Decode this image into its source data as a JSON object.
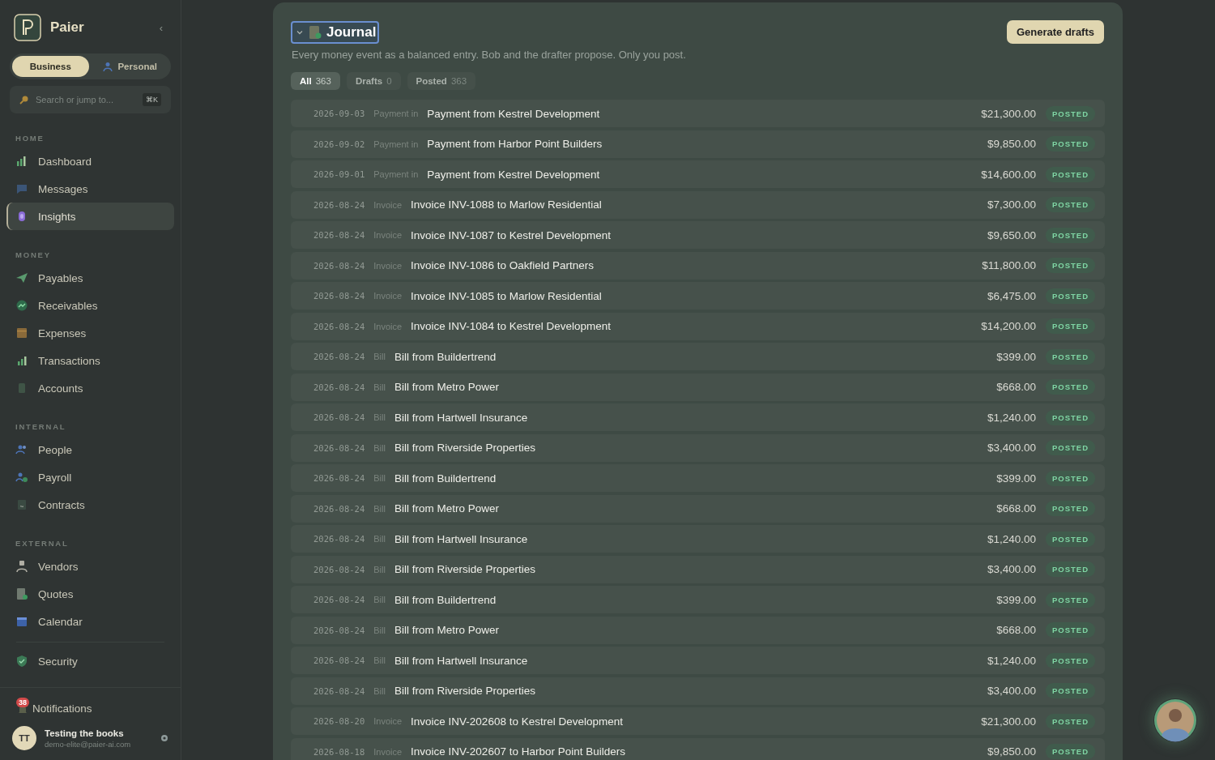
{
  "sidebar": {
    "brand": "Paier",
    "collapse_glyph": "‹",
    "modes": [
      {
        "label": "Business",
        "selected": true
      },
      {
        "label": "Personal",
        "selected": false
      }
    ],
    "search": {
      "placeholder": "Search or jump to...",
      "shortcut": "⌘K"
    },
    "sections": [
      {
        "title": "HOME",
        "items": [
          {
            "label": "Dashboard",
            "selected": false
          },
          {
            "label": "Messages",
            "selected": false
          },
          {
            "label": "Insights",
            "selected": true
          }
        ]
      },
      {
        "title": "MONEY",
        "items": [
          {
            "label": "Payables",
            "selected": false
          },
          {
            "label": "Receivables",
            "selected": false
          },
          {
            "label": "Expenses",
            "selected": false
          },
          {
            "label": "Transactions",
            "selected": false
          },
          {
            "label": "Accounts",
            "selected": false
          }
        ]
      },
      {
        "title": "INTERNAL",
        "items": [
          {
            "label": "People",
            "selected": false
          },
          {
            "label": "Payroll",
            "selected": false
          },
          {
            "label": "Contracts",
            "selected": false
          }
        ]
      },
      {
        "title": "EXTERNAL",
        "items": [
          {
            "label": "Vendors",
            "selected": false
          },
          {
            "label": "Quotes",
            "selected": false
          },
          {
            "label": "Calendar",
            "selected": false
          }
        ]
      }
    ],
    "footer_items": [
      {
        "label": "Security",
        "selected": false
      }
    ],
    "notifications": {
      "label": "Notifications",
      "count": "38"
    },
    "user": {
      "initials": "TT",
      "name": "Testing the books",
      "email": "demo-elite@paier-ai.com"
    }
  },
  "journal": {
    "title": "Journal",
    "description": "Every money event as a balanced entry. Bob and the drafter propose. Only you post.",
    "action": "Generate drafts",
    "tabs": [
      {
        "label": "All",
        "count": "363",
        "selected": true
      },
      {
        "label": "Drafts",
        "count": "0",
        "selected": false
      },
      {
        "label": "Posted",
        "count": "363",
        "selected": false
      }
    ],
    "rows": [
      {
        "date": "2026-09-03",
        "type": "Payment in",
        "description": "Payment from Kestrel Development",
        "amount": "$21,300.00",
        "status": "POSTED"
      },
      {
        "date": "2026-09-02",
        "type": "Payment in",
        "description": "Payment from Harbor Point Builders",
        "amount": "$9,850.00",
        "status": "POSTED"
      },
      {
        "date": "2026-09-01",
        "type": "Payment in",
        "description": "Payment from Kestrel Development",
        "amount": "$14,600.00",
        "status": "POSTED"
      },
      {
        "date": "2026-08-24",
        "type": "Invoice",
        "description": "Invoice INV-1088 to Marlow Residential",
        "amount": "$7,300.00",
        "status": "POSTED"
      },
      {
        "date": "2026-08-24",
        "type": "Invoice",
        "description": "Invoice INV-1087 to Kestrel Development",
        "amount": "$9,650.00",
        "status": "POSTED"
      },
      {
        "date": "2026-08-24",
        "type": "Invoice",
        "description": "Invoice INV-1086 to Oakfield Partners",
        "amount": "$11,800.00",
        "status": "POSTED"
      },
      {
        "date": "2026-08-24",
        "type": "Invoice",
        "description": "Invoice INV-1085 to Marlow Residential",
        "amount": "$6,475.00",
        "status": "POSTED"
      },
      {
        "date": "2026-08-24",
        "type": "Invoice",
        "description": "Invoice INV-1084 to Kestrel Development",
        "amount": "$14,200.00",
        "status": "POSTED"
      },
      {
        "date": "2026-08-24",
        "type": "Bill",
        "description": "Bill from Buildertrend",
        "amount": "$399.00",
        "status": "POSTED"
      },
      {
        "date": "2026-08-24",
        "type": "Bill",
        "description": "Bill from Metro Power",
        "amount": "$668.00",
        "status": "POSTED"
      },
      {
        "date": "2026-08-24",
        "type": "Bill",
        "description": "Bill from Hartwell Insurance",
        "amount": "$1,240.00",
        "status": "POSTED"
      },
      {
        "date": "2026-08-24",
        "type": "Bill",
        "description": "Bill from Riverside Properties",
        "amount": "$3,400.00",
        "status": "POSTED"
      },
      {
        "date": "2026-08-24",
        "type": "Bill",
        "description": "Bill from Buildertrend",
        "amount": "$399.00",
        "status": "POSTED"
      },
      {
        "date": "2026-08-24",
        "type": "Bill",
        "description": "Bill from Metro Power",
        "amount": "$668.00",
        "status": "POSTED"
      },
      {
        "date": "2026-08-24",
        "type": "Bill",
        "description": "Bill from Hartwell Insurance",
        "amount": "$1,240.00",
        "status": "POSTED"
      },
      {
        "date": "2026-08-24",
        "type": "Bill",
        "description": "Bill from Riverside Properties",
        "amount": "$3,400.00",
        "status": "POSTED"
      },
      {
        "date": "2026-08-24",
        "type": "Bill",
        "description": "Bill from Buildertrend",
        "amount": "$399.00",
        "status": "POSTED"
      },
      {
        "date": "2026-08-24",
        "type": "Bill",
        "description": "Bill from Metro Power",
        "amount": "$668.00",
        "status": "POSTED"
      },
      {
        "date": "2026-08-24",
        "type": "Bill",
        "description": "Bill from Hartwell Insurance",
        "amount": "$1,240.00",
        "status": "POSTED"
      },
      {
        "date": "2026-08-24",
        "type": "Bill",
        "description": "Bill from Riverside Properties",
        "amount": "$3,400.00",
        "status": "POSTED"
      },
      {
        "date": "2026-08-20",
        "type": "Invoice",
        "description": "Invoice INV-202608 to Kestrel Development",
        "amount": "$21,300.00",
        "status": "POSTED"
      },
      {
        "date": "2026-08-18",
        "type": "Invoice",
        "description": "Invoice INV-202607 to Harbor Point Builders",
        "amount": "$9,850.00",
        "status": "POSTED"
      }
    ]
  }
}
